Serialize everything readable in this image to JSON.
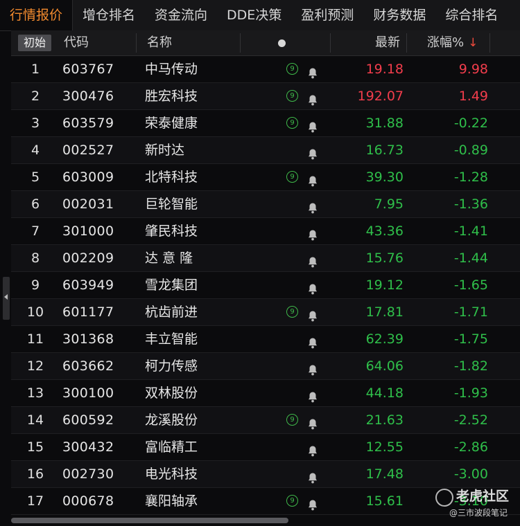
{
  "tabs": [
    "行情报价",
    "增仓排名",
    "资金流向",
    "DDE决策",
    "盈利预测",
    "财务数据",
    "综合排名"
  ],
  "header": {
    "chushi": "初始",
    "code": "代码",
    "name": "名称",
    "latest": "最新",
    "change": "涨幅%",
    "sort_arrow": "↓"
  },
  "rows": [
    {
      "idx": "1",
      "code": "603767",
      "name": "中马传动",
      "nine": true,
      "price": "19.18",
      "chg": "9.98",
      "dir": "up"
    },
    {
      "idx": "2",
      "code": "300476",
      "name": "胜宏科技",
      "nine": true,
      "price": "192.07",
      "chg": "1.49",
      "dir": "up"
    },
    {
      "idx": "3",
      "code": "603579",
      "name": "荣泰健康",
      "nine": true,
      "price": "31.88",
      "chg": "-0.22",
      "dir": "down"
    },
    {
      "idx": "4",
      "code": "002527",
      "name": "新时达",
      "nine": false,
      "price": "16.73",
      "chg": "-0.89",
      "dir": "down"
    },
    {
      "idx": "5",
      "code": "603009",
      "name": "北特科技",
      "nine": true,
      "price": "39.30",
      "chg": "-1.28",
      "dir": "down"
    },
    {
      "idx": "6",
      "code": "002031",
      "name": "巨轮智能",
      "nine": false,
      "price": "7.95",
      "chg": "-1.36",
      "dir": "down"
    },
    {
      "idx": "7",
      "code": "301000",
      "name": "肇民科技",
      "nine": false,
      "price": "43.36",
      "chg": "-1.41",
      "dir": "down"
    },
    {
      "idx": "8",
      "code": "002209",
      "name": "达 意 隆",
      "nine": false,
      "price": "15.76",
      "chg": "-1.44",
      "dir": "down"
    },
    {
      "idx": "9",
      "code": "603949",
      "name": "雪龙集团",
      "nine": false,
      "price": "19.12",
      "chg": "-1.65",
      "dir": "down"
    },
    {
      "idx": "10",
      "code": "601177",
      "name": "杭齿前进",
      "nine": true,
      "price": "17.81",
      "chg": "-1.71",
      "dir": "down"
    },
    {
      "idx": "11",
      "code": "301368",
      "name": "丰立智能",
      "nine": false,
      "price": "62.39",
      "chg": "-1.75",
      "dir": "down"
    },
    {
      "idx": "12",
      "code": "603662",
      "name": "柯力传感",
      "nine": false,
      "price": "64.06",
      "chg": "-1.82",
      "dir": "down"
    },
    {
      "idx": "13",
      "code": "300100",
      "name": "双林股份",
      "nine": false,
      "price": "44.18",
      "chg": "-1.93",
      "dir": "down"
    },
    {
      "idx": "14",
      "code": "600592",
      "name": "龙溪股份",
      "nine": true,
      "price": "21.63",
      "chg": "-2.52",
      "dir": "down"
    },
    {
      "idx": "15",
      "code": "300432",
      "name": "富临精工",
      "nine": false,
      "price": "12.55",
      "chg": "-2.86",
      "dir": "down"
    },
    {
      "idx": "16",
      "code": "002730",
      "name": "电光科技",
      "nine": false,
      "price": "17.48",
      "chg": "-3.00",
      "dir": "down"
    },
    {
      "idx": "17",
      "code": "000678",
      "name": "襄阳轴承",
      "nine": true,
      "price": "15.61",
      "chg": "-3.10",
      "dir": "down"
    }
  ],
  "watermark": {
    "title": "老虎社区",
    "subtitle": "@三市波段笔记"
  },
  "colors": {
    "up": "#f23d4c",
    "down": "#2fbf4a",
    "accent": "#f28a2e"
  }
}
